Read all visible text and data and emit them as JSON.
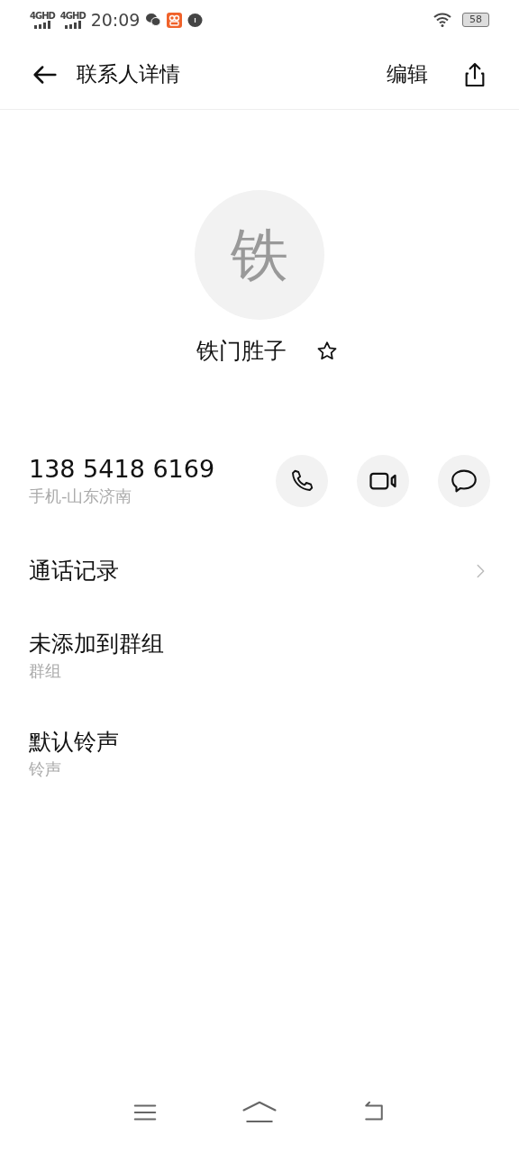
{
  "status_bar": {
    "signals": [
      "4GHD",
      "4GHD"
    ],
    "time": "20:09",
    "battery": "58"
  },
  "header": {
    "title": "联系人详情",
    "edit": "编辑"
  },
  "contact": {
    "avatar": "铁",
    "name": "铁门胜子",
    "starred": false
  },
  "phone": {
    "number": "138 5418 6169",
    "label": "手机-山东济南"
  },
  "rows": [
    {
      "kind": "link",
      "title": "通话记录"
    },
    {
      "kind": "info",
      "title": "未添加到群组",
      "subtitle": "群组"
    },
    {
      "kind": "info",
      "title": "默认铃声",
      "subtitle": "铃声"
    }
  ]
}
